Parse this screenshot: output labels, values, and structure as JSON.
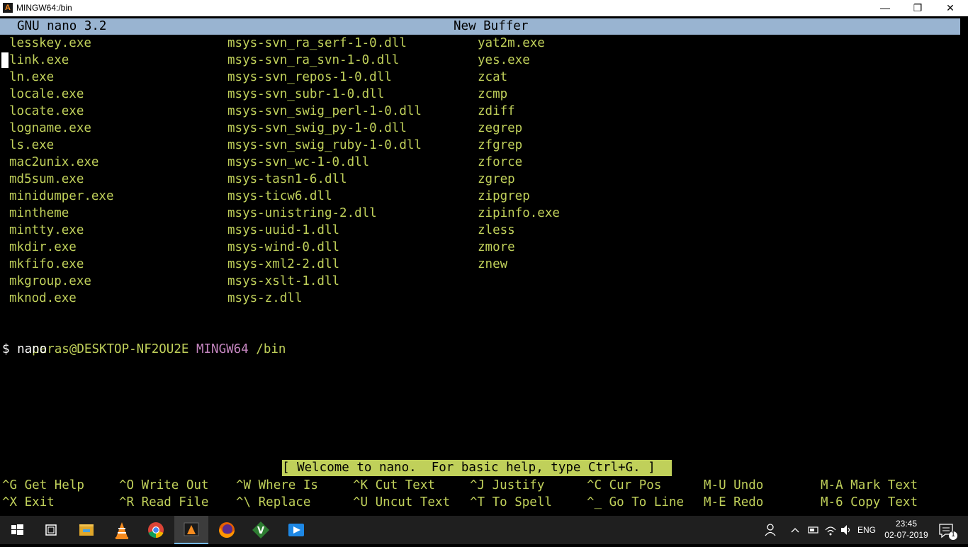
{
  "window": {
    "title": "MINGW64:/bin",
    "minimize": "—",
    "maximize": "❐",
    "close": "✕"
  },
  "nano": {
    "version": "GNU nano 3.2",
    "buffer": "New Buffer",
    "status": "[ Welcome to nano.  For basic help, type Ctrl+G. ]"
  },
  "listing": {
    "col1": [
      "lesskey.exe",
      "link.exe",
      "ln.exe",
      "locale.exe",
      "locate.exe",
      "logname.exe",
      "ls.exe",
      "mac2unix.exe",
      "md5sum.exe",
      "minidumper.exe",
      "mintheme",
      "mintty.exe",
      "mkdir.exe",
      "mkfifo.exe",
      "mkgroup.exe",
      "mknod.exe"
    ],
    "col2": [
      "msys-svn_ra_serf-1-0.dll",
      "msys-svn_ra_svn-1-0.dll",
      "msys-svn_repos-1-0.dll",
      "msys-svn_subr-1-0.dll",
      "msys-svn_swig_perl-1-0.dll",
      "msys-svn_swig_py-1-0.dll",
      "msys-svn_swig_ruby-1-0.dll",
      "msys-svn_wc-1-0.dll",
      "msys-tasn1-6.dll",
      "msys-ticw6.dll",
      "msys-unistring-2.dll",
      "msys-uuid-1.dll",
      "msys-wind-0.dll",
      "msys-xml2-2.dll",
      "msys-xslt-1.dll",
      "msys-z.dll"
    ],
    "col3": [
      "yat2m.exe",
      "yes.exe",
      "zcat",
      "zcmp",
      "zdiff",
      "zegrep",
      "zfgrep",
      "zforce",
      "zgrep",
      "zipgrep",
      "zipinfo.exe",
      "zless",
      "zmore",
      "znew"
    ]
  },
  "prompt": {
    "user": "paras@DESKTOP-NF2OU2E",
    "env": "MINGW64",
    "path": "/bin",
    "command": "$ nano"
  },
  "shortcuts": {
    "row1": [
      {
        "key": "^G",
        "label": "Get Help"
      },
      {
        "key": "^O",
        "label": "Write Out"
      },
      {
        "key": "^W",
        "label": "Where Is"
      },
      {
        "key": "^K",
        "label": "Cut Text"
      },
      {
        "key": "^J",
        "label": "Justify"
      },
      {
        "key": "^C",
        "label": "Cur Pos"
      },
      {
        "key": "M-U",
        "label": "Undo"
      },
      {
        "key": "M-A",
        "label": "Mark Text"
      }
    ],
    "row2": [
      {
        "key": "^X",
        "label": "Exit"
      },
      {
        "key": "^R",
        "label": "Read File"
      },
      {
        "key": "^\\",
        "label": "Replace"
      },
      {
        "key": "^U",
        "label": "Uncut Text"
      },
      {
        "key": "^T",
        "label": "To Spell"
      },
      {
        "key": "^_",
        "label": "Go To Line"
      },
      {
        "key": "M-E",
        "label": "Redo"
      },
      {
        "key": "M-6",
        "label": "Copy Text"
      }
    ]
  },
  "taskbar": {
    "lang": "ENG",
    "time": "23:45",
    "date": "02-07-2019",
    "notifications": "1"
  },
  "colors": {
    "text": "#c0d05a",
    "header": "#99b4d1",
    "user": "#c0d05a",
    "env": "#c586c0",
    "path": "#c0d05a"
  }
}
